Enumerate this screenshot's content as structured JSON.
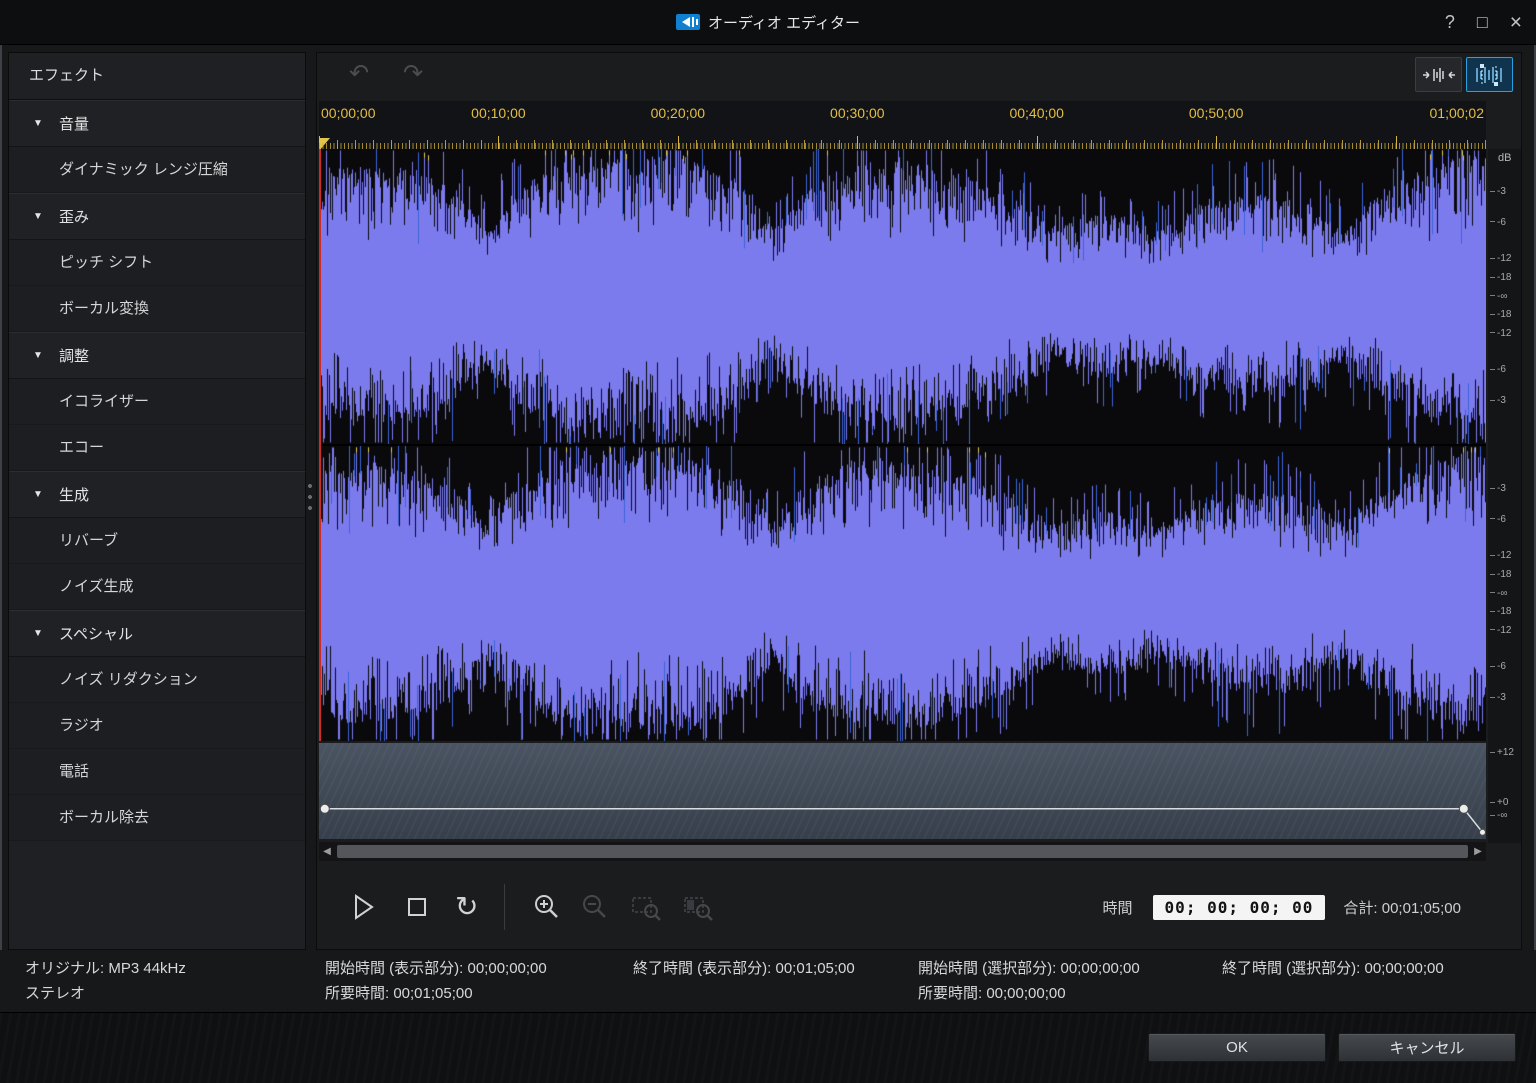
{
  "window": {
    "title": "オーディオ エディター",
    "help": "?",
    "maximize": "□",
    "close": "×"
  },
  "sidebar": {
    "header": "エフェクト",
    "groups": [
      {
        "label": "音量",
        "items": [
          "ダイナミック レンジ圧縮"
        ]
      },
      {
        "label": "歪み",
        "items": [
          "ピッチ シフト",
          "ボーカル変換"
        ]
      },
      {
        "label": "調整",
        "items": [
          "イコライザー",
          "エコー"
        ]
      },
      {
        "label": "生成",
        "items": [
          "リバーブ",
          "ノイズ生成"
        ]
      },
      {
        "label": "スペシャル",
        "items": [
          "ノイズ リダクション",
          "ラジオ",
          "電話",
          "ボーカル除去"
        ]
      }
    ]
  },
  "ruler": {
    "labels": [
      "00;00;00",
      "00;10;00",
      "00;20;00",
      "00;30;00",
      "00;40;00",
      "00;50;00",
      "01;00;02"
    ]
  },
  "scale": {
    "db": "dB",
    "channel_labels": [
      "-3",
      "-6",
      "-12",
      "-18",
      "-∞",
      "-18",
      "-12",
      "-6",
      "-3"
    ],
    "envelope_labels": [
      "+12",
      "+0",
      "-∞"
    ]
  },
  "envelope": {
    "points": [
      {
        "x": 0.005,
        "y": 0.685
      },
      {
        "x": 0.981,
        "y": 0.685
      },
      {
        "x": 0.997,
        "y": 0.93
      }
    ]
  },
  "transport": {
    "time_label": "時間",
    "time_value": "00; 00; 00; 00",
    "total_label": "合計:",
    "total_value": "00;01;05;00"
  },
  "status": {
    "original_line1": "オリジナル: MP3 44kHz",
    "original_line2": "ステレオ",
    "display_start": "開始時間 (表示部分): 00;00;00;00",
    "display_end": "終了時間 (表示部分): 00;01;05;00",
    "select_start": "開始時間 (選択部分): 00;00;00;00",
    "select_end": "終了時間 (選択部分): 00;00;00;00",
    "display_duration": "所要時間: 00;01;05;00",
    "select_duration": "所要時間: 00;00;00;00"
  },
  "footer": {
    "ok": "OK",
    "cancel": "キャンセル"
  },
  "colors": {
    "waveform": "#7c7bee",
    "wave_accent": "#3c64d8",
    "wave_peak": "#e2cb40",
    "wave_bg": "#0a0a0d",
    "accent": "#2a9fe0",
    "ruler_text": "#e3bd45",
    "playhead": "#cf2b26"
  }
}
